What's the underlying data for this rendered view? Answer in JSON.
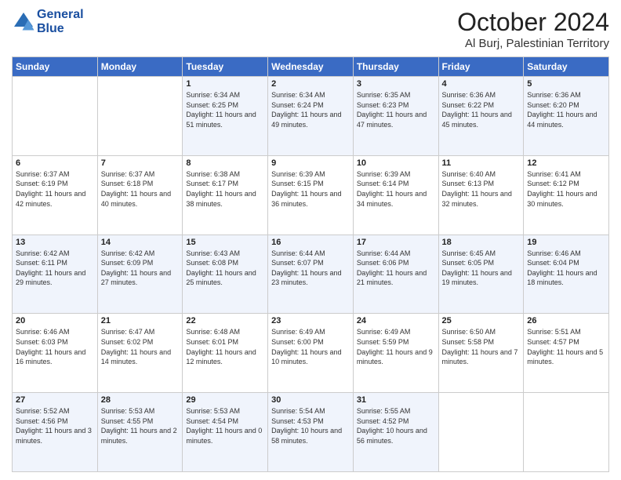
{
  "header": {
    "logo_line1": "General",
    "logo_line2": "Blue",
    "month": "October 2024",
    "location": "Al Burj, Palestinian Territory"
  },
  "weekdays": [
    "Sunday",
    "Monday",
    "Tuesday",
    "Wednesday",
    "Thursday",
    "Friday",
    "Saturday"
  ],
  "weeks": [
    [
      {
        "day": "",
        "sunrise": "",
        "sunset": "",
        "daylight": ""
      },
      {
        "day": "",
        "sunrise": "",
        "sunset": "",
        "daylight": ""
      },
      {
        "day": "1",
        "sunrise": "Sunrise: 6:34 AM",
        "sunset": "Sunset: 6:25 PM",
        "daylight": "Daylight: 11 hours and 51 minutes."
      },
      {
        "day": "2",
        "sunrise": "Sunrise: 6:34 AM",
        "sunset": "Sunset: 6:24 PM",
        "daylight": "Daylight: 11 hours and 49 minutes."
      },
      {
        "day": "3",
        "sunrise": "Sunrise: 6:35 AM",
        "sunset": "Sunset: 6:23 PM",
        "daylight": "Daylight: 11 hours and 47 minutes."
      },
      {
        "day": "4",
        "sunrise": "Sunrise: 6:36 AM",
        "sunset": "Sunset: 6:22 PM",
        "daylight": "Daylight: 11 hours and 45 minutes."
      },
      {
        "day": "5",
        "sunrise": "Sunrise: 6:36 AM",
        "sunset": "Sunset: 6:20 PM",
        "daylight": "Daylight: 11 hours and 44 minutes."
      }
    ],
    [
      {
        "day": "6",
        "sunrise": "Sunrise: 6:37 AM",
        "sunset": "Sunset: 6:19 PM",
        "daylight": "Daylight: 11 hours and 42 minutes."
      },
      {
        "day": "7",
        "sunrise": "Sunrise: 6:37 AM",
        "sunset": "Sunset: 6:18 PM",
        "daylight": "Daylight: 11 hours and 40 minutes."
      },
      {
        "day": "8",
        "sunrise": "Sunrise: 6:38 AM",
        "sunset": "Sunset: 6:17 PM",
        "daylight": "Daylight: 11 hours and 38 minutes."
      },
      {
        "day": "9",
        "sunrise": "Sunrise: 6:39 AM",
        "sunset": "Sunset: 6:15 PM",
        "daylight": "Daylight: 11 hours and 36 minutes."
      },
      {
        "day": "10",
        "sunrise": "Sunrise: 6:39 AM",
        "sunset": "Sunset: 6:14 PM",
        "daylight": "Daylight: 11 hours and 34 minutes."
      },
      {
        "day": "11",
        "sunrise": "Sunrise: 6:40 AM",
        "sunset": "Sunset: 6:13 PM",
        "daylight": "Daylight: 11 hours and 32 minutes."
      },
      {
        "day": "12",
        "sunrise": "Sunrise: 6:41 AM",
        "sunset": "Sunset: 6:12 PM",
        "daylight": "Daylight: 11 hours and 30 minutes."
      }
    ],
    [
      {
        "day": "13",
        "sunrise": "Sunrise: 6:42 AM",
        "sunset": "Sunset: 6:11 PM",
        "daylight": "Daylight: 11 hours and 29 minutes."
      },
      {
        "day": "14",
        "sunrise": "Sunrise: 6:42 AM",
        "sunset": "Sunset: 6:09 PM",
        "daylight": "Daylight: 11 hours and 27 minutes."
      },
      {
        "day": "15",
        "sunrise": "Sunrise: 6:43 AM",
        "sunset": "Sunset: 6:08 PM",
        "daylight": "Daylight: 11 hours and 25 minutes."
      },
      {
        "day": "16",
        "sunrise": "Sunrise: 6:44 AM",
        "sunset": "Sunset: 6:07 PM",
        "daylight": "Daylight: 11 hours and 23 minutes."
      },
      {
        "day": "17",
        "sunrise": "Sunrise: 6:44 AM",
        "sunset": "Sunset: 6:06 PM",
        "daylight": "Daylight: 11 hours and 21 minutes."
      },
      {
        "day": "18",
        "sunrise": "Sunrise: 6:45 AM",
        "sunset": "Sunset: 6:05 PM",
        "daylight": "Daylight: 11 hours and 19 minutes."
      },
      {
        "day": "19",
        "sunrise": "Sunrise: 6:46 AM",
        "sunset": "Sunset: 6:04 PM",
        "daylight": "Daylight: 11 hours and 18 minutes."
      }
    ],
    [
      {
        "day": "20",
        "sunrise": "Sunrise: 6:46 AM",
        "sunset": "Sunset: 6:03 PM",
        "daylight": "Daylight: 11 hours and 16 minutes."
      },
      {
        "day": "21",
        "sunrise": "Sunrise: 6:47 AM",
        "sunset": "Sunset: 6:02 PM",
        "daylight": "Daylight: 11 hours and 14 minutes."
      },
      {
        "day": "22",
        "sunrise": "Sunrise: 6:48 AM",
        "sunset": "Sunset: 6:01 PM",
        "daylight": "Daylight: 11 hours and 12 minutes."
      },
      {
        "day": "23",
        "sunrise": "Sunrise: 6:49 AM",
        "sunset": "Sunset: 6:00 PM",
        "daylight": "Daylight: 11 hours and 10 minutes."
      },
      {
        "day": "24",
        "sunrise": "Sunrise: 6:49 AM",
        "sunset": "Sunset: 5:59 PM",
        "daylight": "Daylight: 11 hours and 9 minutes."
      },
      {
        "day": "25",
        "sunrise": "Sunrise: 6:50 AM",
        "sunset": "Sunset: 5:58 PM",
        "daylight": "Daylight: 11 hours and 7 minutes."
      },
      {
        "day": "26",
        "sunrise": "Sunrise: 5:51 AM",
        "sunset": "Sunset: 4:57 PM",
        "daylight": "Daylight: 11 hours and 5 minutes."
      }
    ],
    [
      {
        "day": "27",
        "sunrise": "Sunrise: 5:52 AM",
        "sunset": "Sunset: 4:56 PM",
        "daylight": "Daylight: 11 hours and 3 minutes."
      },
      {
        "day": "28",
        "sunrise": "Sunrise: 5:53 AM",
        "sunset": "Sunset: 4:55 PM",
        "daylight": "Daylight: 11 hours and 2 minutes."
      },
      {
        "day": "29",
        "sunrise": "Sunrise: 5:53 AM",
        "sunset": "Sunset: 4:54 PM",
        "daylight": "Daylight: 11 hours and 0 minutes."
      },
      {
        "day": "30",
        "sunrise": "Sunrise: 5:54 AM",
        "sunset": "Sunset: 4:53 PM",
        "daylight": "Daylight: 10 hours and 58 minutes."
      },
      {
        "day": "31",
        "sunrise": "Sunrise: 5:55 AM",
        "sunset": "Sunset: 4:52 PM",
        "daylight": "Daylight: 10 hours and 56 minutes."
      },
      {
        "day": "",
        "sunrise": "",
        "sunset": "",
        "daylight": ""
      },
      {
        "day": "",
        "sunrise": "",
        "sunset": "",
        "daylight": ""
      }
    ]
  ]
}
